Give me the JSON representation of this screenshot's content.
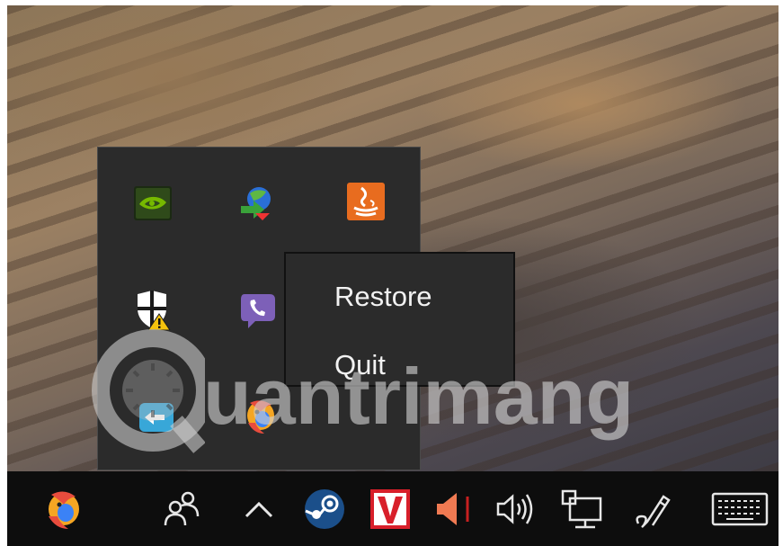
{
  "tray_overflow": {
    "icons": [
      {
        "name": "nvidia-icon"
      },
      {
        "name": "internet-download-manager-icon"
      },
      {
        "name": "java-update-icon"
      },
      {
        "name": "windows-security-warning-icon"
      },
      {
        "name": "viber-icon"
      },
      {
        "name": "teamviewer-icon"
      },
      {
        "name": "app-mascot-icon"
      }
    ]
  },
  "context_menu": {
    "items": [
      {
        "label": "Restore"
      },
      {
        "label": "Quit"
      }
    ]
  },
  "watermark": {
    "text": "uantrimang"
  },
  "taskbar": {
    "icons": [
      {
        "name": "app-mascot-icon"
      },
      {
        "name": "people-icon"
      },
      {
        "name": "show-hidden-icons-chevron-icon"
      },
      {
        "name": "steam-icon"
      },
      {
        "name": "vivaldi-icon"
      },
      {
        "name": "muted-speaker-icon"
      },
      {
        "name": "volume-icon"
      },
      {
        "name": "network-icon"
      },
      {
        "name": "pen-ink-icon"
      },
      {
        "name": "touch-keyboard-icon"
      }
    ]
  },
  "colors": {
    "menu_bg": "#2b2b2b",
    "taskbar_bg": "#0d0d0d",
    "menu_text": "#f2f2f2"
  }
}
